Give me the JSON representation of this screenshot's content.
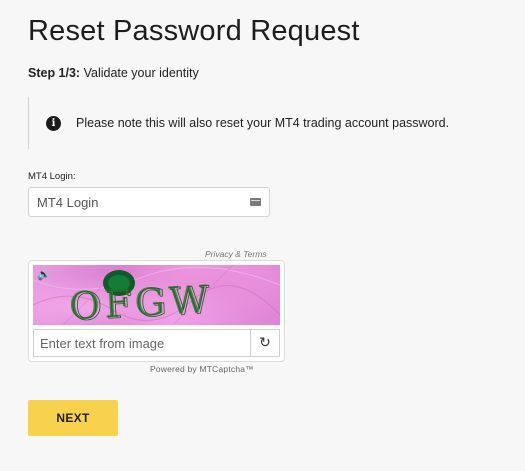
{
  "header": {
    "title": "Reset Password Request",
    "step_prefix": "Step 1/3:",
    "step_text": " Validate your identity"
  },
  "notice": {
    "icon": "info-icon",
    "text": "Please note this will also reset your MT4 trading account password."
  },
  "login_field": {
    "label": "MT4 Login:",
    "placeholder": "MT4 Login",
    "value": "",
    "icon": "card-icon"
  },
  "captcha": {
    "privacy_link": "Privacy & Terms",
    "image_text": "OFGW",
    "audio_icon": "speaker-icon",
    "refresh_icon": "refresh-icon",
    "input_placeholder": "Enter text from image",
    "input_value": "",
    "powered_by": "Powered by MTCaptcha™"
  },
  "actions": {
    "next_label": "NEXT",
    "next_color": "#f8d24d"
  }
}
